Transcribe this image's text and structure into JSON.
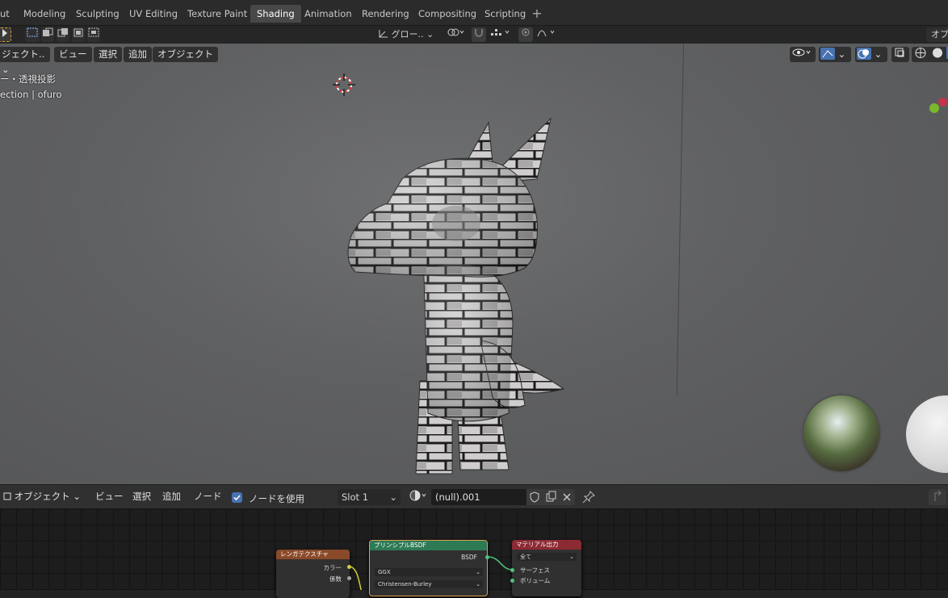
{
  "workspace_tabs": [
    {
      "label": "ut",
      "active": false
    },
    {
      "label": "Modeling",
      "active": false
    },
    {
      "label": "Sculpting",
      "active": false
    },
    {
      "label": "UV Editing",
      "active": false
    },
    {
      "label": "Texture Paint",
      "active": false
    },
    {
      "label": "Shading",
      "active": true
    },
    {
      "label": "Animation",
      "active": false
    },
    {
      "label": "Rendering",
      "active": false
    },
    {
      "label": "Compositing",
      "active": false
    },
    {
      "label": "Scripting",
      "active": false
    }
  ],
  "add_workspace": "+",
  "toolbar": {
    "transform_orientation": "グロー..",
    "top_right_label": "オプ"
  },
  "viewport": {
    "mode_label": "ジェクト..",
    "menus": [
      "ビュー",
      "選択",
      "追加",
      "オブジェクト"
    ],
    "view_info": "ー・透視投影",
    "collection_info": "ection | ofuro"
  },
  "node_editor": {
    "mode_label": "オブジェクト",
    "menus": [
      "ビュー",
      "選択",
      "追加",
      "ノード"
    ],
    "use_nodes_label": "ノードを使用",
    "use_nodes_checked": true,
    "slot": "Slot 1",
    "material_name": "(null).001",
    "nodes": {
      "brick": {
        "title": "レンガテクスチャ",
        "out1": "カラー",
        "out2": "係数"
      },
      "bsdf": {
        "title": "プリンシプルBSDF",
        "out": "BSDF",
        "dist": "GGX",
        "sss": "Christensen-Burley"
      },
      "output": {
        "title": "マテリアル出力",
        "target": "全て",
        "in1": "サーフェス",
        "in2": "ボリューム"
      }
    }
  },
  "colors": {
    "accent": "#4772b3",
    "active_tab": "#484848",
    "node_brick_header": "#8a4a2a",
    "node_bsdf_header": "#2e7a55",
    "node_output_header": "#8c2a34"
  }
}
